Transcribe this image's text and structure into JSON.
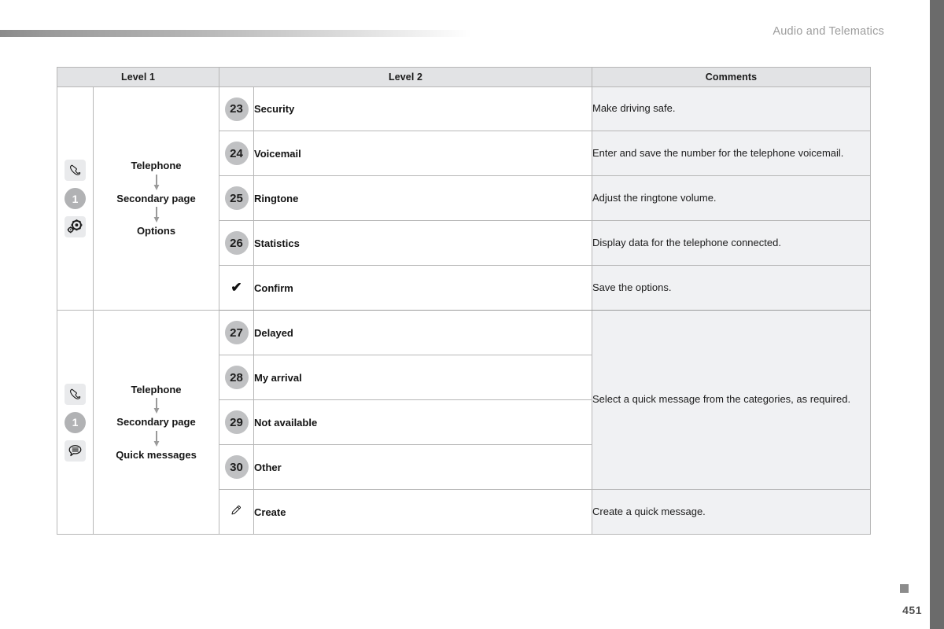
{
  "page": {
    "section_title": "Audio and Telematics",
    "page_number": "451",
    "accent_gray": "#6b6b6b",
    "header_bg": "#e2e3e5",
    "comment_bg": "#f0f1f3",
    "badge_bg": "#c0c1c3"
  },
  "table": {
    "headers": {
      "level1": "Level 1",
      "level2": "Level 2",
      "comments": "Comments"
    },
    "sections": [
      {
        "icons": [
          "phone-handset-icon",
          "number-one-badge",
          "settings-gears-icon"
        ],
        "number_badge": "1",
        "flow": [
          "Telephone",
          "Secondary page",
          "Options"
        ],
        "rows": [
          {
            "badge": "23",
            "badge_type": "number",
            "label": "Security",
            "comment": "Make driving safe."
          },
          {
            "badge": "24",
            "badge_type": "number",
            "label": "Voicemail",
            "comment": "Enter and save the number for the telephone voicemail."
          },
          {
            "badge": "25",
            "badge_type": "number",
            "label": "Ringtone",
            "comment": "Adjust the ringtone volume."
          },
          {
            "badge": "26",
            "badge_type": "number",
            "label": "Statistics",
            "comment": "Display data for the telephone connected."
          },
          {
            "badge": "✔",
            "badge_type": "check",
            "label": "Confirm",
            "comment": "Save the options."
          }
        ]
      },
      {
        "icons": [
          "phone-handset-icon",
          "number-one-badge",
          "message-bubble-icon"
        ],
        "number_badge": "1",
        "flow": [
          "Telephone",
          "Secondary page",
          "Quick messages"
        ],
        "merged_comment": "Select a quick message from the categories, as required.",
        "rows": [
          {
            "badge": "27",
            "badge_type": "number",
            "label": "Delayed"
          },
          {
            "badge": "28",
            "badge_type": "number",
            "label": "My arrival"
          },
          {
            "badge": "29",
            "badge_type": "number",
            "label": "Not available"
          },
          {
            "badge": "30",
            "badge_type": "number",
            "label": "Other"
          },
          {
            "badge": "pencil-icon",
            "badge_type": "icon",
            "label": "Create",
            "comment": "Create a quick message."
          }
        ]
      }
    ]
  }
}
